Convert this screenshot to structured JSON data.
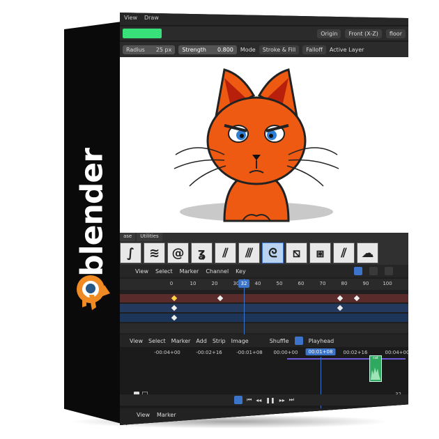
{
  "brand": {
    "name": "blender",
    "colors": {
      "orange": "#f08a22",
      "blue": "#265787",
      "spine": "#0a0a0a"
    }
  },
  "menubar": {
    "items": [
      "View",
      "Draw"
    ]
  },
  "header_row1": {
    "origin": "Origin",
    "view": "Front (X-Z)",
    "plane": "floor"
  },
  "header_row2": {
    "color_swatch": "#38e07a",
    "radius_label": "Radius",
    "radius_value": "25 px",
    "strength_label": "Strength",
    "strength_value": "0.800",
    "mode_label": "Mode",
    "mode_value": "Stroke & Fill",
    "falloff": "Falloff",
    "layer": "Active Layer"
  },
  "brush_panel": {
    "tabs": [
      "ase",
      "Utilities"
    ],
    "brushes": [
      {
        "icon": "stroke-brush-icon",
        "glyph": "∫"
      },
      {
        "icon": "marker-brush-icon",
        "glyph": "≋"
      },
      {
        "icon": "at-brush-icon",
        "glyph": "@"
      },
      {
        "icon": "scribble-brush-icon",
        "glyph": "ʓ"
      },
      {
        "icon": "ink-brush-icon",
        "glyph": "⫽"
      },
      {
        "icon": "hatch-brush-icon",
        "glyph": "⫻"
      },
      {
        "icon": "curve-brush-icon",
        "glyph": "ᘓ",
        "active": true
      },
      {
        "icon": "erase-brush-icon",
        "glyph": "⧅"
      },
      {
        "icon": "cross-brush-icon",
        "glyph": "⧆"
      },
      {
        "icon": "red-brush-icon",
        "glyph": "⫽"
      },
      {
        "icon": "fill-brush-icon",
        "glyph": "☁"
      }
    ]
  },
  "dopesheet": {
    "menu": [
      "View",
      "Select",
      "Marker",
      "Channel",
      "Key"
    ],
    "frame_ticks": [
      "0",
      "10",
      "20",
      "30",
      "40",
      "50",
      "60",
      "70",
      "80",
      "90",
      "100"
    ],
    "current_frame": "32"
  },
  "sequencer": {
    "menu": [
      "View",
      "Select",
      "Marker",
      "Add",
      "Strip",
      "Image"
    ],
    "shuffle": "Shuffle",
    "playhead_label": "Playhead",
    "times": [
      "-00:04+00",
      "-00:02+16",
      "-00:01+08",
      "00:00+00",
      "00:02+16",
      "00:04+00"
    ],
    "current_time": "00:01+08",
    "strip_label": "cat",
    "frame_end": "32"
  },
  "bottom": {
    "menu": [
      "View",
      "Marker"
    ]
  }
}
